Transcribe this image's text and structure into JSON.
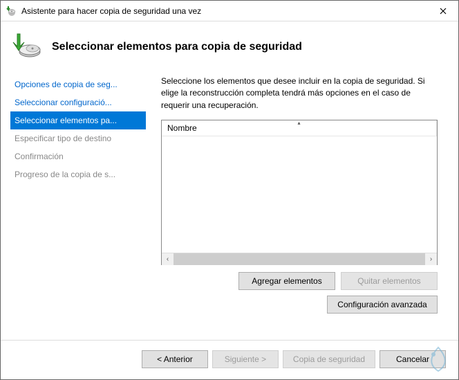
{
  "window": {
    "title": "Asistente para hacer copia de seguridad una vez"
  },
  "header": {
    "heading": "Seleccionar elementos para copia de seguridad"
  },
  "sidebar": {
    "steps": [
      {
        "label": "Opciones de copia de seg...",
        "state": "link"
      },
      {
        "label": "Seleccionar configuració...",
        "state": "link"
      },
      {
        "label": "Seleccionar elementos pa...",
        "state": "active"
      },
      {
        "label": "Especificar tipo de destino",
        "state": "muted"
      },
      {
        "label": "Confirmación",
        "state": "muted"
      },
      {
        "label": "Progreso de la copia de s...",
        "state": "muted"
      }
    ]
  },
  "main": {
    "instructions": "Seleccione los elementos que desee incluir en la copia de seguridad. Si elige la reconstrucción completa tendrá más opciones en el caso de requerir una recuperación.",
    "column_header": "Nombre",
    "buttons": {
      "add": "Agregar elementos",
      "remove": "Quitar elementos",
      "advanced": "Configuración avanzada"
    }
  },
  "footer": {
    "back": "< Anterior",
    "next": "Siguiente >",
    "backup": "Copia de seguridad",
    "cancel": "Cancelar"
  },
  "icons": {
    "app_icon": "backup-wizard-icon",
    "header_icon": "backup-drive-arrow-icon",
    "close": "close-icon"
  }
}
